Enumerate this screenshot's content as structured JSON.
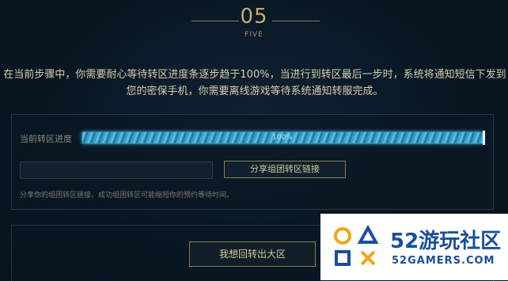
{
  "step": {
    "number": "05",
    "label": "FIVE"
  },
  "description": "在当前步骤中，你需要耐心等待转区进度条逐步趋于100%，当进行到转区最后一步时，系统将通知短信下发到您的密保手机，你需要离线游戏等待系统通知转服完成。",
  "progress": {
    "label": "当前转区进度",
    "value": 1.0,
    "text": "100%",
    "fill_color": "#3fb0d8"
  },
  "share": {
    "input_value": "",
    "button_label": "分享组团转区链接",
    "hint": "分享你的组团转区链接，成功组团转区可能缩短你的预约等待时间。"
  },
  "transfer": {
    "button_label": "我想回转出大区"
  },
  "watermark": {
    "brand": "52游玩社区",
    "site": "52GAMERS.COM"
  }
}
